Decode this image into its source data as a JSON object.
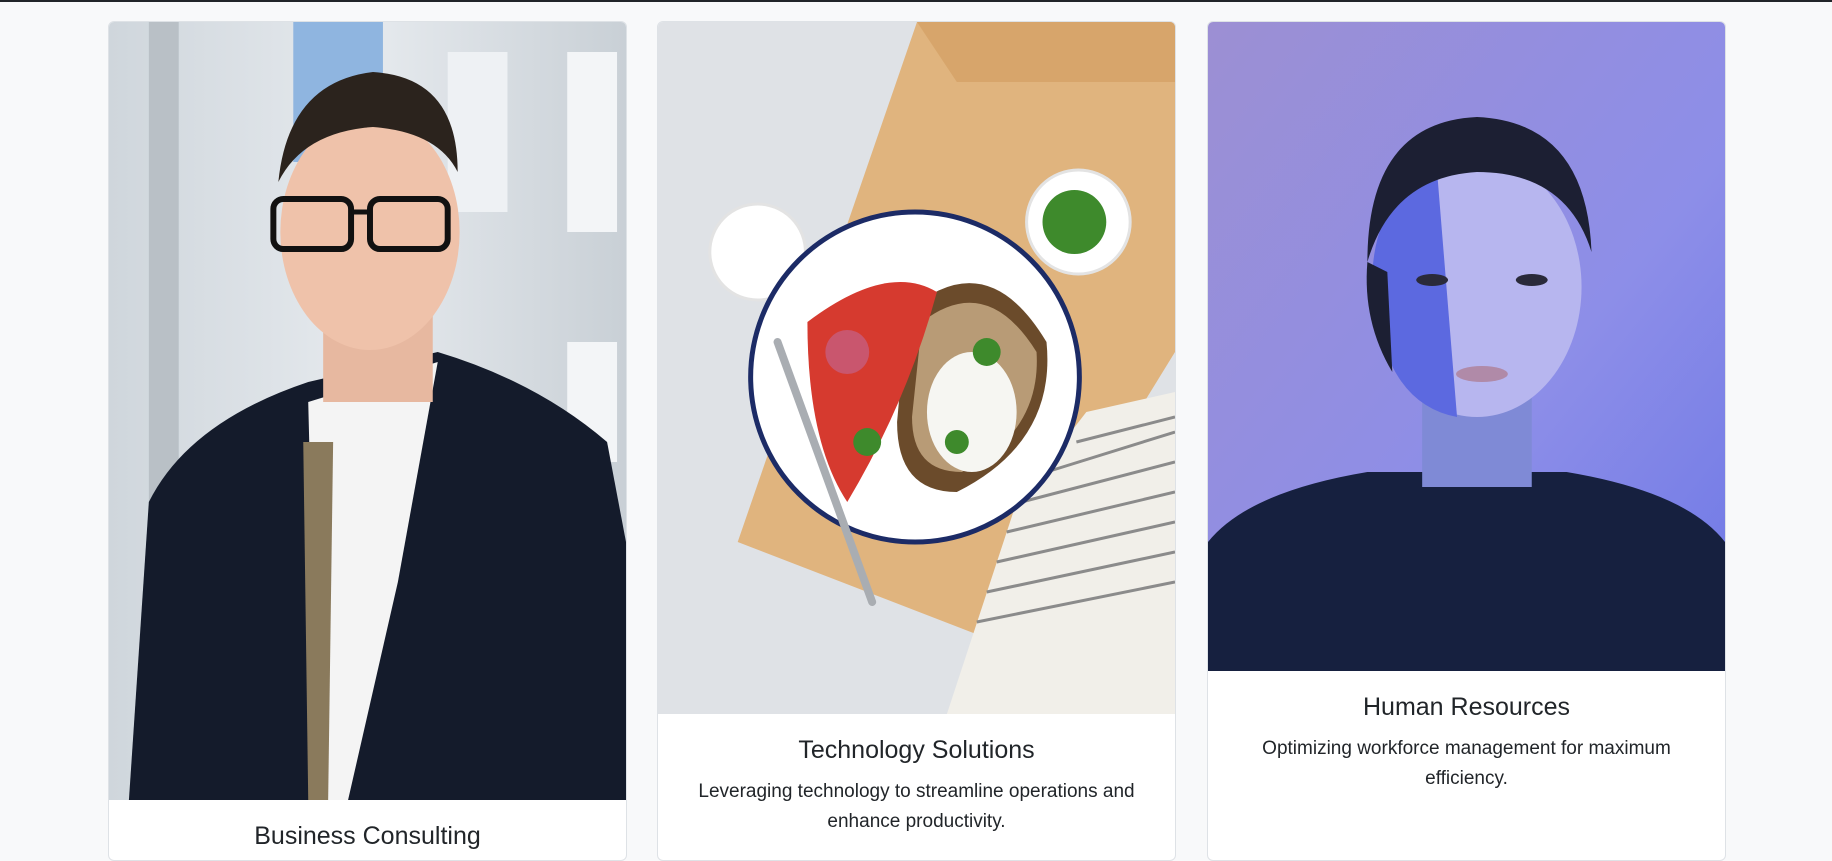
{
  "services": [
    {
      "title": "Business Consulting",
      "description": "",
      "image_subject": "man in glasses and dark blazer"
    },
    {
      "title": "Technology Solutions",
      "description": "Leveraging technology to streamline operations and enhance productivity.",
      "image_subject": "plate of food on wooden board"
    },
    {
      "title": "Human Resources",
      "description": "Optimizing workforce management for maximum efficiency.",
      "image_subject": "woman portrait in blue light"
    }
  ]
}
